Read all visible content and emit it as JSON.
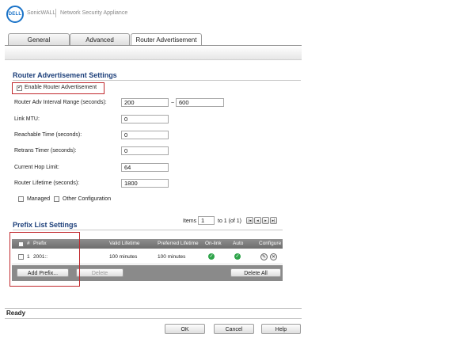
{
  "header": {
    "logo_text": "DELL",
    "brand": "SonicWALL",
    "product": "Network Security Appliance"
  },
  "tabs": [
    {
      "label": "General",
      "active": false
    },
    {
      "label": "Advanced",
      "active": false
    },
    {
      "label": "Router Advertisement",
      "active": true
    }
  ],
  "ra_settings": {
    "title": "Router Advertisement Settings",
    "enable_label": "Enable Router Advertisement",
    "enable_checked": true,
    "interval_label": "Router Adv Interval Range (seconds):",
    "interval_min": "200",
    "interval_sep": "~",
    "interval_max": "600",
    "link_mtu_label": "Link MTU:",
    "link_mtu": "0",
    "reachable_label": "Reachable Time (seconds):",
    "reachable": "0",
    "retrans_label": "Retrans Timer (seconds):",
    "retrans": "0",
    "hop_label": "Current Hop Limit:",
    "hop": "64",
    "lifetime_label": "Router Lifetime (seconds):",
    "lifetime": "1800",
    "managed_label": "Managed",
    "other_config_label": "Other Configuration"
  },
  "prefix_list": {
    "title": "Prefix List Settings",
    "items_label": "Items",
    "items_value": "1",
    "items_range": "to 1 (of 1)",
    "columns": {
      "num": "#",
      "prefix": "Prefix",
      "valid": "Valid Lifetime",
      "preferred": "Preferred Lifetime",
      "onlink": "On-link",
      "auto": "Auto",
      "configure": "Configure"
    },
    "rows": [
      {
        "num": "1",
        "prefix": "2001::",
        "valid": "100 minutes",
        "preferred": "100 minutes",
        "onlink": true,
        "auto": true
      }
    ],
    "add_label": "Add Prefix...",
    "delete_label": "Delete",
    "delete_all_label": "Delete All"
  },
  "status": {
    "text": "Ready"
  },
  "footer": {
    "ok": "OK",
    "cancel": "Cancel",
    "help": "Help"
  }
}
